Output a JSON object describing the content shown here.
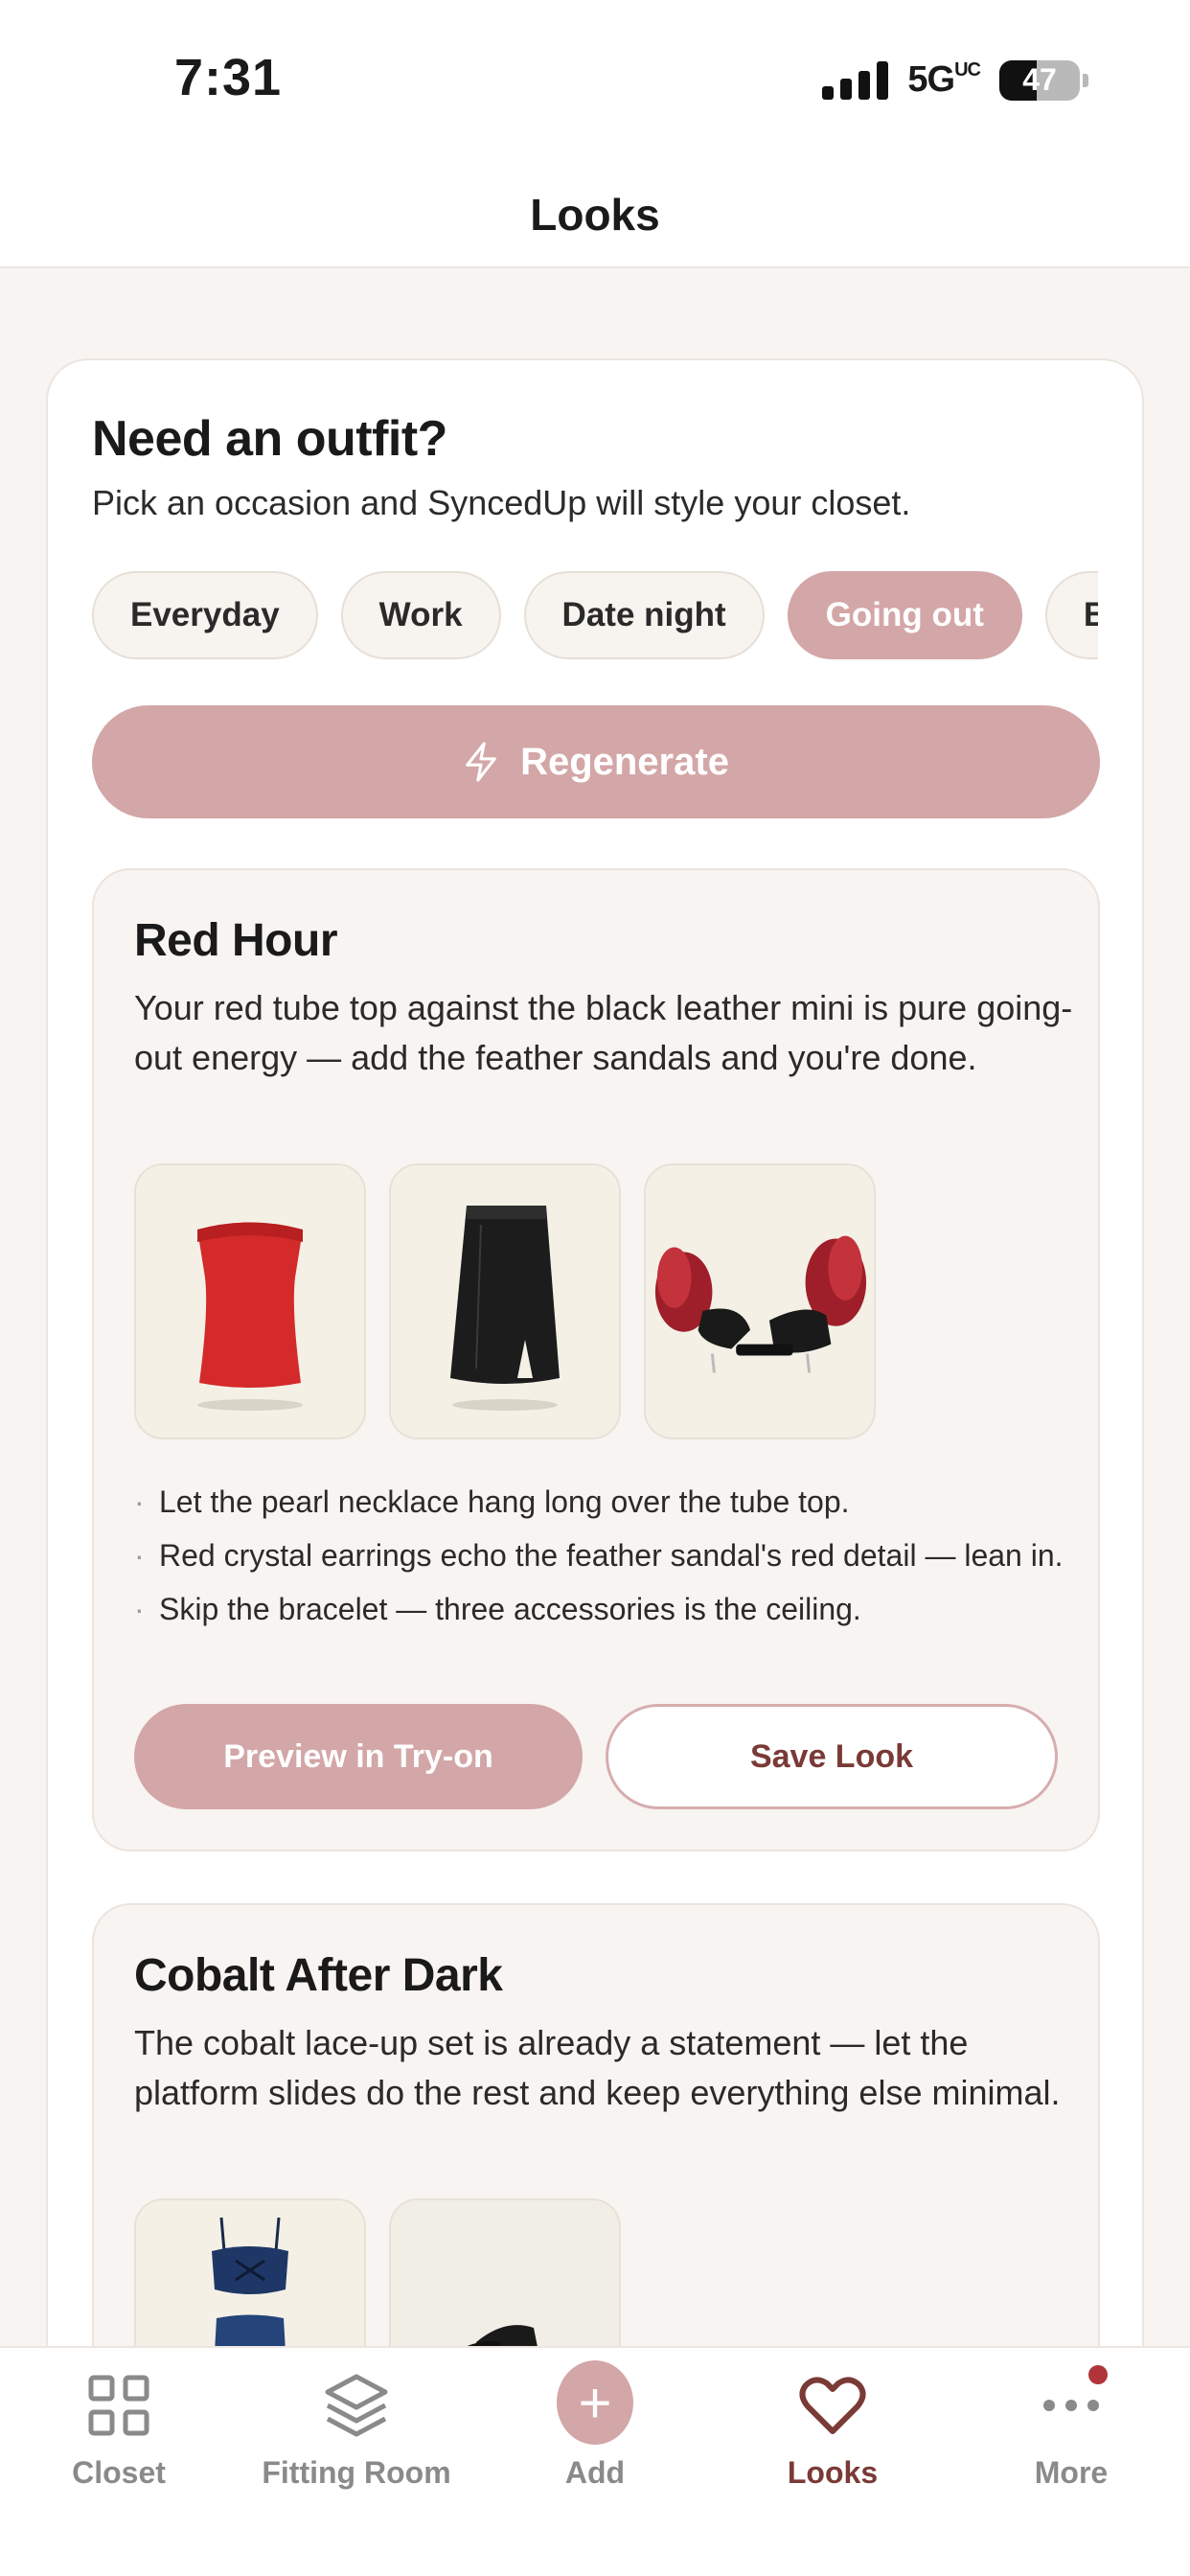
{
  "status": {
    "time": "7:31",
    "network": "5G",
    "network_suffix": "UC",
    "battery": "47"
  },
  "header": {
    "title": "Looks"
  },
  "prompt": {
    "title": "Need an outfit?",
    "subtitle": "Pick an occasion and SyncedUp will style your closet.",
    "occasions": [
      "Everyday",
      "Work",
      "Date night",
      "Going out",
      "B"
    ],
    "selected": "Going out",
    "regenerate_label": "Regenerate"
  },
  "looks": [
    {
      "title": "Red Hour",
      "description": "Your red tube top against the black leather mini is pure going-out energy — add the feather sandals and you're done.",
      "items": [
        "red-tube-top",
        "black-leather-mini-skirt",
        "feather-sandals"
      ],
      "tips": [
        "Let the pearl necklace hang long over the tube top.",
        "Red crystal earrings echo the feather sandal's red detail — lean in.",
        "Skip the bracelet — three accessories is the ceiling."
      ],
      "preview_label": "Preview in Try-on",
      "save_label": "Save Look"
    },
    {
      "title": "Cobalt After Dark",
      "description": "The cobalt lace-up set is already a statement — let the platform slides do the rest and keep everything else minimal.",
      "items": [
        "cobalt-lace-up-set",
        "platform-slides"
      ]
    }
  ],
  "tabs": [
    {
      "label": "Closet",
      "icon": "grid-icon"
    },
    {
      "label": "Fitting Room",
      "icon": "layers-icon"
    },
    {
      "label": "Add",
      "icon": "plus-icon"
    },
    {
      "label": "Looks",
      "icon": "heart-icon",
      "active": true
    },
    {
      "label": "More",
      "icon": "more-dots-icon",
      "badge": true
    }
  ],
  "colors": {
    "accent": "#d3a6a7",
    "accent_dark": "#7a3a36",
    "background": "#f8f4f1",
    "badge": "#b0343a"
  }
}
